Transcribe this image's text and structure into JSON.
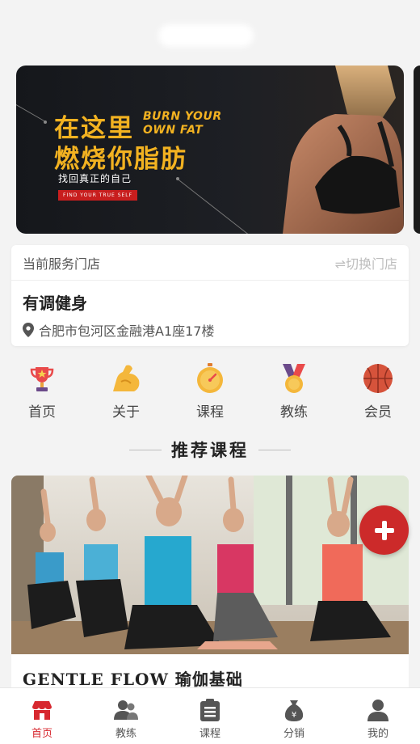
{
  "banner": {
    "headline_line1": "在这里",
    "headline_line2": "燃烧你脂肪",
    "english_line1": "BURN YOUR",
    "english_line2": "OWN FAT",
    "subtitle": "找回真正的自己",
    "tag": "FIND YOUR TRUE SELF"
  },
  "store": {
    "label": "当前服务门店",
    "switch_label": "⇌切换门店",
    "name": "有调健身",
    "address": "合肥市包河区金融港A1座17楼"
  },
  "quick_nav": [
    {
      "label": "首页",
      "icon": "trophy-icon"
    },
    {
      "label": "关于",
      "icon": "flexed-arm-icon"
    },
    {
      "label": "课程",
      "icon": "stopwatch-icon"
    },
    {
      "label": "教练",
      "icon": "medal-icon"
    },
    {
      "label": "会员",
      "icon": "basketball-icon"
    }
  ],
  "section": {
    "title": "推荐课程"
  },
  "course": {
    "title": "GENTLE FLOW 瑜伽基础"
  },
  "fab": {
    "icon": "plus-icon"
  },
  "tabbar": [
    {
      "label": "首页",
      "icon": "store-icon",
      "active": true
    },
    {
      "label": "教练",
      "icon": "users-icon",
      "active": false
    },
    {
      "label": "课程",
      "icon": "clipboard-icon",
      "active": false
    },
    {
      "label": "分销",
      "icon": "money-bag-icon",
      "active": false
    },
    {
      "label": "我的",
      "icon": "person-icon",
      "active": false
    }
  ],
  "colors": {
    "accent": "#d7282f",
    "banner_text": "#f2b221",
    "page_bg": "#f3f3f3"
  }
}
